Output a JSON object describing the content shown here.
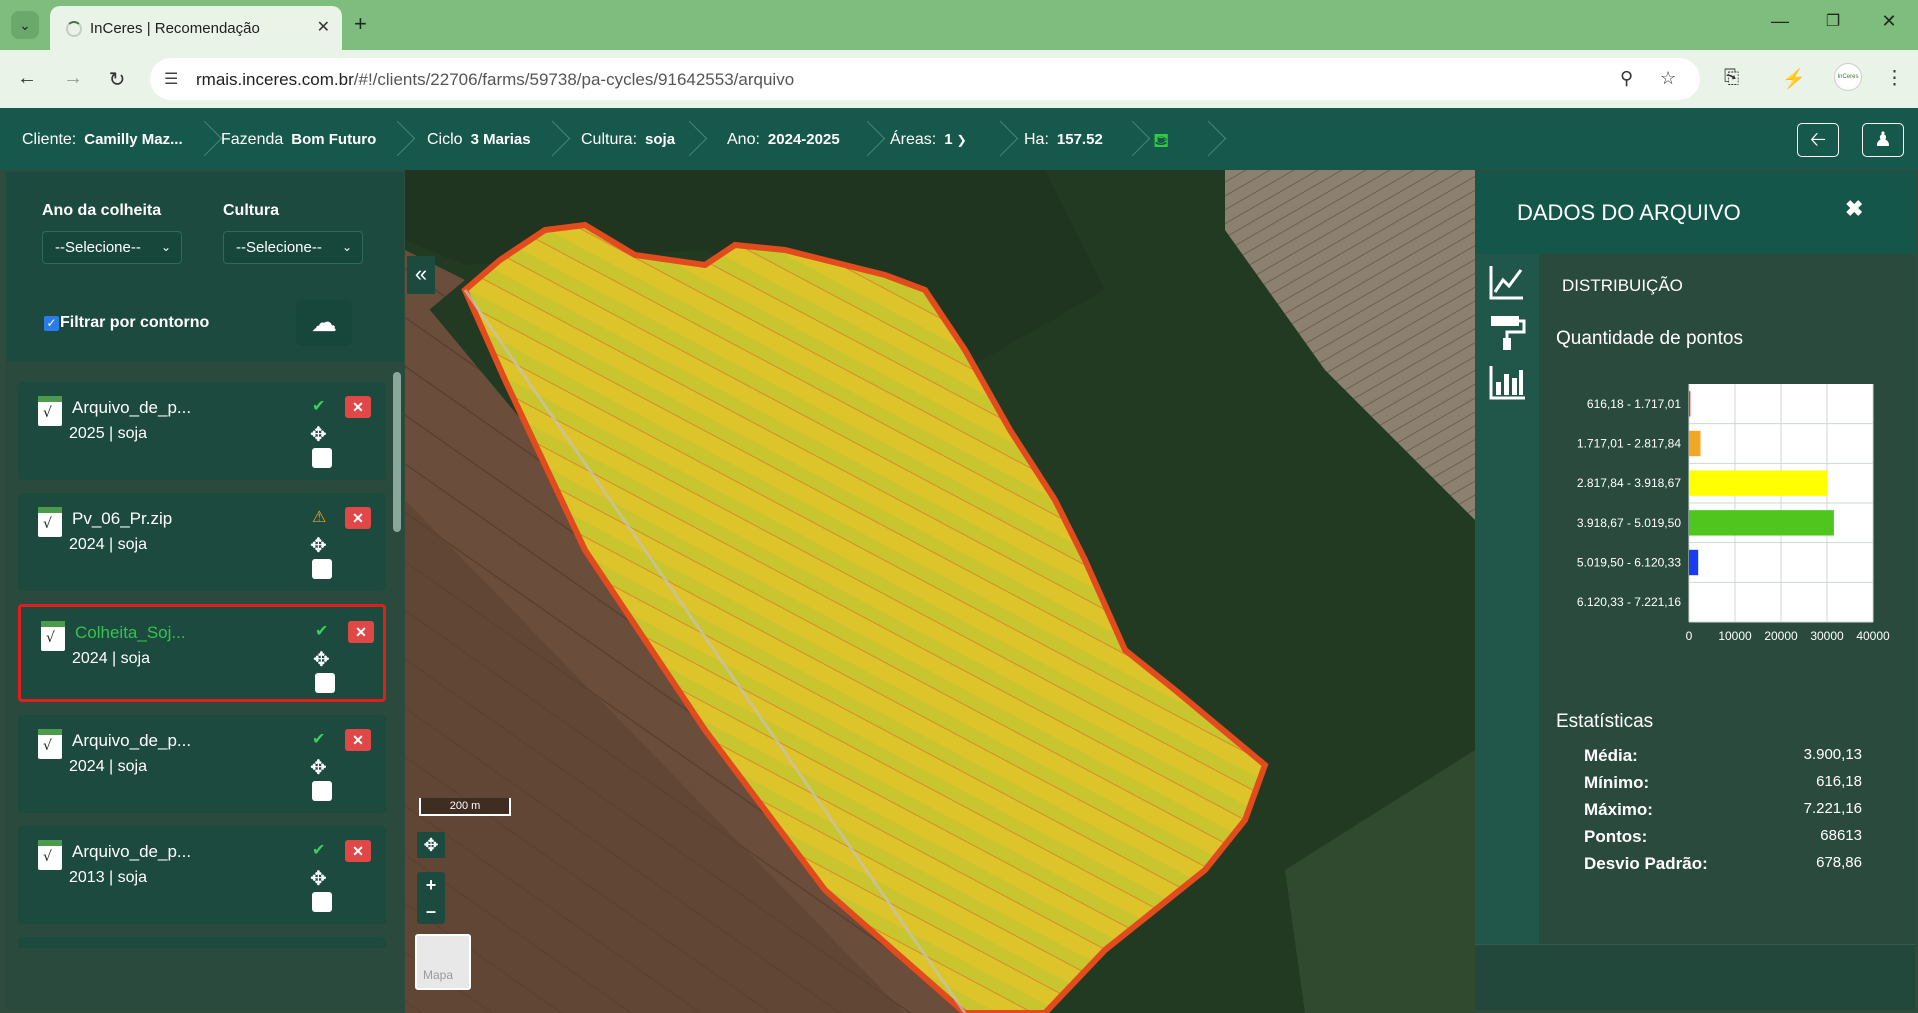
{
  "browser": {
    "tab_title": "InCeres | Recomendação",
    "url_domain": "rmais.inceres.com.br",
    "url_path": "/#!/clients/22706/farms/59738/pa-cycles/91642553/arquivo",
    "profile_label": "InCeres"
  },
  "header": {
    "cliente_label": "Cliente:",
    "cliente_value": "Camilly Maz...",
    "fazenda_label": "Fazenda",
    "fazenda_value": "Bom Futuro",
    "ciclo_label": "Ciclo",
    "ciclo_value": "3 Marias",
    "cultura_label": "Cultura:",
    "cultura_value": "soja",
    "ano_label": "Ano:",
    "ano_value": "2024-2025",
    "areas_label": "Áreas:",
    "areas_value": "1",
    "ha_label": "Ha:",
    "ha_value": "157.52"
  },
  "filters": {
    "ano_label": "Ano da colheita",
    "ano_select": "--Selecione--",
    "cultura_label": "Cultura",
    "cultura_select": "--Selecione--",
    "filtrar_label": "Filtrar por contorno",
    "filtrar_checked": true
  },
  "files": [
    {
      "name": "Arquivo_de_p...",
      "meta": "2025 | soja",
      "status": "ok"
    },
    {
      "name": "Pv_06_Pr.zip",
      "meta": "2024 | soja",
      "status": "warning"
    },
    {
      "name": "Colheita_Soj...",
      "meta": "2024 | soja",
      "status": "ok",
      "selected": true
    },
    {
      "name": "Arquivo_de_p...",
      "meta": "2024 | soja",
      "status": "ok"
    },
    {
      "name": "Arquivo_de_p...",
      "meta": "2013 | soja",
      "status": "ok"
    }
  ],
  "map": {
    "scale_label": "200 m",
    "layer_label": "Mapa"
  },
  "right_panel": {
    "title": "DADOS DO ARQUIVO",
    "section": "DISTRIBUIÇÃO",
    "chart_title": "Quantidade de pontos",
    "stats_title": "Estatísticas",
    "stats": [
      {
        "label": "Média:",
        "value": "3.900,13"
      },
      {
        "label": "Mínimo:",
        "value": "616,18"
      },
      {
        "label": "Máximo:",
        "value": "7.221,16"
      },
      {
        "label": "Pontos:",
        "value": "68613"
      },
      {
        "label": "Desvio Padrão:",
        "value": "678,86"
      }
    ]
  },
  "chart_data": {
    "type": "bar",
    "orientation": "horizontal",
    "title": "Quantidade de pontos",
    "categories": [
      "616,18 - 1.717,01",
      "1.717,01 - 2.817,84",
      "2.817,84 - 3.918,67",
      "3.918,67 - 5.019,50",
      "5.019,50 - 6.120,33",
      "6.120,33 - 7.221,16"
    ],
    "values": [
      300,
      2500,
      30000,
      31500,
      2000,
      0
    ],
    "colors": [
      "#e23a2a",
      "#f5a623",
      "#ffff00",
      "#4fc61e",
      "#1a3cf0",
      "#cccccc"
    ],
    "xticks": [
      0,
      10000,
      20000,
      30000,
      40000
    ],
    "xlim": [
      0,
      40000
    ],
    "grid": true
  },
  "colors": {
    "app_header": "#17584c",
    "panel": "#2a4a3e",
    "accent_green": "#36c14f",
    "delete_red": "#e04848"
  }
}
